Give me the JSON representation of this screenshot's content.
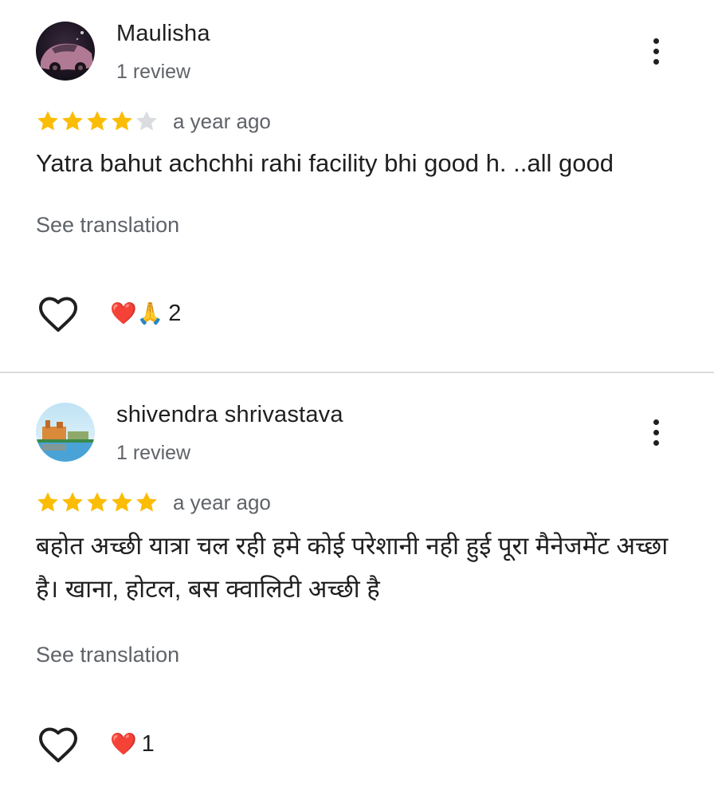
{
  "reviews": [
    {
      "name": "Maulisha",
      "subline": "1 review",
      "rating": 4,
      "max_rating": 5,
      "date": "a year ago",
      "text": "Yatra bahut achchhi rahi facility bhi good h. ..all good",
      "see_translation": "See translation",
      "reactions": "❤️🙏",
      "reaction_count": "2"
    },
    {
      "name": "shivendra shrivastava",
      "subline": "1 review",
      "rating": 5,
      "max_rating": 5,
      "date": "a year ago",
      "text": "बहोत अच्छी यात्रा चल रही हमे कोई परेशानी नही हुई पूरा मैनेजमेंट अच्छा है। खाना, होटल, बस क्वालिटी अच्छी है",
      "see_translation": "See translation",
      "reactions": "❤️",
      "reaction_count": "1"
    }
  ],
  "colors": {
    "star_filled": "#fbbc04",
    "star_empty": "#dadce0",
    "text_primary": "#1f1f1f",
    "text_secondary": "#5f6368",
    "divider": "#dadce0"
  },
  "icons": {
    "menu": "more-vert-icon",
    "like": "heart-outline-icon",
    "star": "star-icon"
  }
}
